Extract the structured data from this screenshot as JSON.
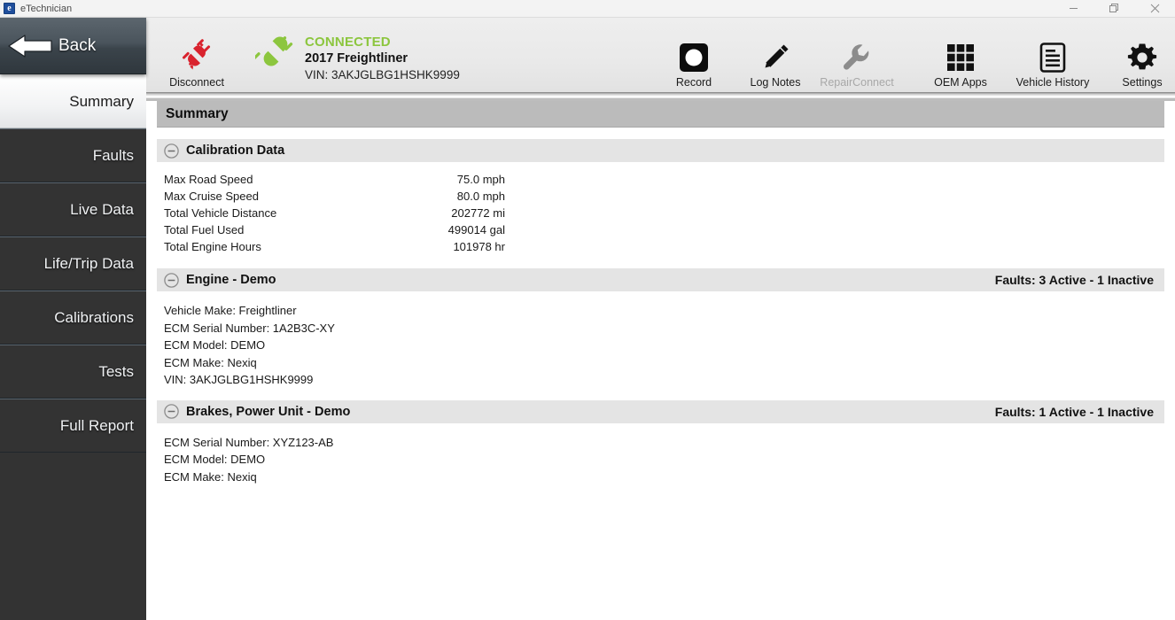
{
  "window": {
    "app_name": "eTechnician",
    "logo_letter": "e",
    "minimize_label": "Minimize",
    "restore_label": "Restore",
    "close_label": "Close"
  },
  "sidebar": {
    "back_label": "Back",
    "items": [
      {
        "label": "Summary",
        "active": true
      },
      {
        "label": "Faults",
        "active": false
      },
      {
        "label": "Live Data",
        "active": false
      },
      {
        "label": "Life/Trip Data",
        "active": false
      },
      {
        "label": "Calibrations",
        "active": false
      },
      {
        "label": "Tests",
        "active": false
      },
      {
        "label": "Full Report",
        "active": false
      }
    ]
  },
  "toolbar": {
    "disconnect_label": "Disconnect",
    "connection": {
      "status": "CONNECTED",
      "vehicle": "2017 Freightliner",
      "vin": "VIN: 3AKJGLBG1HSHK9999",
      "status_color": "#8cc63e"
    },
    "actions": [
      {
        "label": "Record",
        "icon": "record-icon",
        "disabled": false
      },
      {
        "label": "Log Notes",
        "icon": "pencil-icon",
        "disabled": false
      },
      {
        "label": "RepairConnect",
        "icon": "wrench-icon",
        "disabled": true
      },
      {
        "label": "OEM Apps",
        "icon": "grid-icon",
        "disabled": false
      },
      {
        "label": "Vehicle History",
        "icon": "document-icon",
        "disabled": false
      },
      {
        "label": "Settings",
        "icon": "gear-icon",
        "disabled": false
      }
    ]
  },
  "main": {
    "page_title": "Summary",
    "sections": [
      {
        "title": "Calibration Data",
        "faults": "",
        "type": "table",
        "rows": [
          {
            "label": "Max Road Speed",
            "value": "75.0 mph"
          },
          {
            "label": "Max Cruise Speed",
            "value": "80.0 mph"
          },
          {
            "label": "Total Vehicle Distance",
            "value": "202772 mi"
          },
          {
            "label": "Total Fuel Used",
            "value": "499014 gal"
          },
          {
            "label": "Total Engine Hours",
            "value": "101978 hr"
          }
        ]
      },
      {
        "title": "Engine - Demo",
        "faults": "Faults:  3 Active  - 1 Inactive",
        "type": "list",
        "lines": [
          "Vehicle Make: Freightliner",
          "ECM Serial Number: 1A2B3C-XY",
          "ECM Model: DEMO",
          "ECM Make: Nexiq",
          "VIN: 3AKJGLBG1HSHK9999"
        ]
      },
      {
        "title": "Brakes, Power Unit - Demo",
        "faults": "Faults:  1 Active  - 1 Inactive",
        "type": "list",
        "lines": [
          "ECM Serial Number: XYZ123-AB",
          "ECM Model: DEMO",
          "ECM Make: Nexiq"
        ]
      }
    ]
  }
}
